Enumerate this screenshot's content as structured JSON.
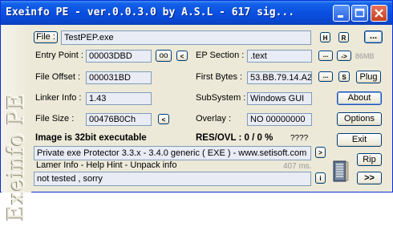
{
  "window": {
    "title": "Exeinfo PE - ver.0.0.3.0  by A.S.L -  617 sig..."
  },
  "side_logo": "Exeinfo PE",
  "file": {
    "label": "File :",
    "value": "TestPEP.exe",
    "h_button": "H",
    "r_button": "R",
    "browse_button": "..."
  },
  "entry_point": {
    "label": "Entry Point :",
    "value": "00003DBD",
    "oo_button": "oo",
    "arrow_button": "<"
  },
  "ep_section": {
    "label": "EP Section :",
    "value": ".text",
    "dots_button": "...",
    "arrow_button": "->",
    "size": "86MB"
  },
  "file_offset": {
    "label": "File Offset :",
    "value": "000031BD"
  },
  "first_bytes": {
    "label": "First Bytes :",
    "value": "53.BB.79.14.A2",
    "dots_button": "...",
    "s_button": "S",
    "plug_button": "Plug"
  },
  "linker_info": {
    "label": "Linker Info :",
    "value": "1.43"
  },
  "subsystem": {
    "label": "SubSystem :",
    "value": "Windows GUI",
    "about_button": "About"
  },
  "file_size": {
    "label": "File Size :",
    "value": "00476B0Ch",
    "arrow_button": "<"
  },
  "overlay": {
    "label": "Overlay :",
    "value": "NO  00000000",
    "options_button": "Options"
  },
  "summary": {
    "exec_text": "Image is 32bit executable",
    "res_ovl": "RES/OVL : 0 / 0 %",
    "unknown": "????",
    "exit_button": "Exit"
  },
  "detect": {
    "value": "Private exe Protector 3.3.x - 3.4.0 generic ( EXE ) - www.setisoft.com",
    "arrow_button": ">",
    "rip_button": "Rip"
  },
  "lamer": {
    "text": "Lamer Info - Help Hint - Unpack info",
    "time": "407 ms."
  },
  "hint": {
    "value": "not tested , sorry",
    "i_button": "i",
    "next_button": ">>"
  }
}
